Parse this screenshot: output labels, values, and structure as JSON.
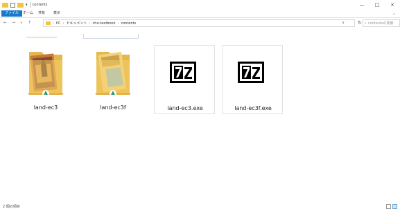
{
  "window": {
    "title": "contents"
  },
  "window_controls": {
    "minimize": "—",
    "maximize": "□",
    "close": "×"
  },
  "ribbon": {
    "tabs": [
      "ファイル",
      "ホーム",
      "共有",
      "表示"
    ]
  },
  "nav": {
    "back": "←",
    "forward": "→",
    "recent": "∨",
    "up": "↑"
  },
  "breadcrumb": {
    "items": [
      "PC",
      "ドキュメント",
      "cho-textbook",
      "contents"
    ],
    "separator": "›"
  },
  "search": {
    "placeholder": "contentsの検索"
  },
  "files": [
    {
      "name": "land-ec3",
      "type": "folder"
    },
    {
      "name": "land-ec3f",
      "type": "folder"
    },
    {
      "name": "land-ec3.exe",
      "type": "7z-exe"
    },
    {
      "name": "land-ec3f.exe",
      "type": "7z-exe"
    }
  ],
  "status": {
    "item_count": "2 個の項目"
  },
  "colors": {
    "accent": "#1979ca",
    "folder": "#f2c443"
  }
}
